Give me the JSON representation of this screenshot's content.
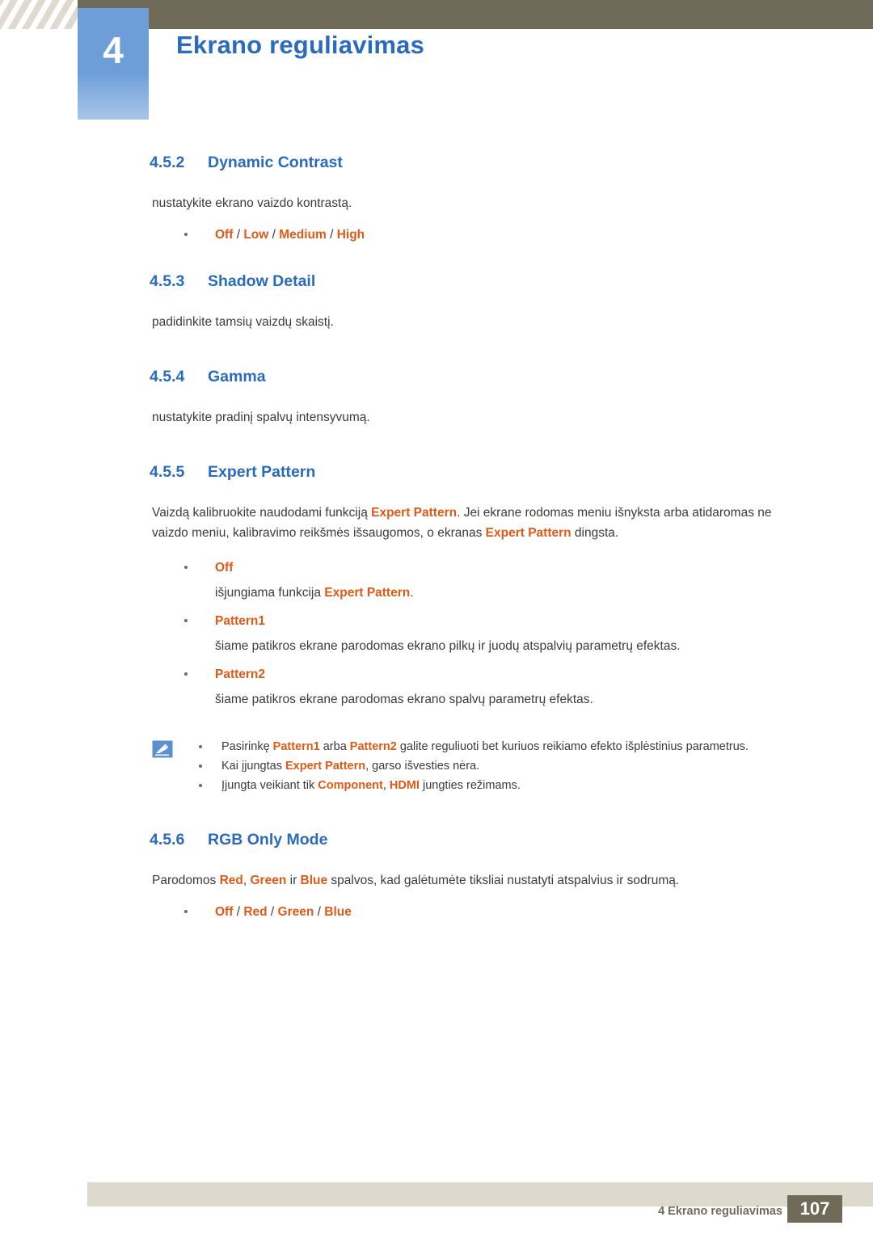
{
  "header": {
    "chapter_number": "4",
    "chapter_title": "Ekrano reguliavimas"
  },
  "sections": [
    {
      "number": "4.5.2",
      "title": "Dynamic Contrast",
      "body": "nustatykite ekrano vaizdo kontrastą.",
      "options": [
        "Off",
        "Low",
        "Medium",
        "High"
      ]
    },
    {
      "number": "4.5.3",
      "title": "Shadow Detail",
      "body": "padidinkite tamsių vaizdų skaistį."
    },
    {
      "number": "4.5.4",
      "title": "Gamma",
      "body": "nustatykite pradinį spalvų intensyvumą."
    },
    {
      "number": "4.5.5",
      "title": "Expert Pattern",
      "intro_a": "Vaizdą kalibruokite naudodami funkciją ",
      "intro_b": "Expert Pattern",
      "intro_c": ". Jei ekrane rodomas meniu išnyksta arba atidaromas ne vaizdo meniu, kalibravimo reikšmės išsaugomos, o ekranas ",
      "intro_d": "Expert Pattern",
      "intro_e": " dingsta.",
      "items": [
        {
          "label": "Off",
          "desc_a": "išjungiama funkcija ",
          "desc_b": "Expert Pattern",
          "desc_c": "."
        },
        {
          "label": "Pattern1",
          "desc_a": "šiame patikros ekrane parodomas ekrano pilkų ir juodų atspalvių parametrų efektas.",
          "desc_b": "",
          "desc_c": ""
        },
        {
          "label": "Pattern2",
          "desc_a": "šiame patikros ekrane parodomas ekrano spalvų parametrų efektas.",
          "desc_b": "",
          "desc_c": ""
        }
      ],
      "notes": [
        {
          "t1": "Pasirinkę ",
          "h1": "Pattern1",
          "t2": " arba ",
          "h2": "Pattern2",
          "t3": " galite reguliuoti bet kuriuos reikiamo efekto išplėstinius parametrus.",
          "h3": "",
          "t4": ""
        },
        {
          "t1": "Kai įjungtas ",
          "h1": "Expert Pattern",
          "t2": ", garso išvesties nėra.",
          "h2": "",
          "t3": "",
          "h3": "",
          "t4": ""
        },
        {
          "t1": "Įjungta veikiant tik ",
          "h1": "Component",
          "t2": ", ",
          "h2": "HDMI",
          "t3": " jungties režimams.",
          "h3": "",
          "t4": ""
        }
      ]
    },
    {
      "number": "4.5.6",
      "title": "RGB Only Mode",
      "rgb_a": "Parodomos ",
      "rgb_r": "Red",
      "rgb_b": ", ",
      "rgb_g": "Green",
      "rgb_c": " ir ",
      "rgb_bl": "Blue",
      "rgb_d": " spalvos, kad galėtumėte tiksliai nustatyti atspalvius ir sodrumą.",
      "options": [
        "Off",
        "Red",
        "Green",
        "Blue"
      ]
    }
  ],
  "footer": {
    "text": "4 Ekrano reguliavimas",
    "page": "107"
  },
  "colors": {
    "heading_blue": "#2a6bbd",
    "accent_orange": "#e05a16",
    "header_bar": "#6f6b58",
    "chapter_box": "#6e9ed8"
  }
}
